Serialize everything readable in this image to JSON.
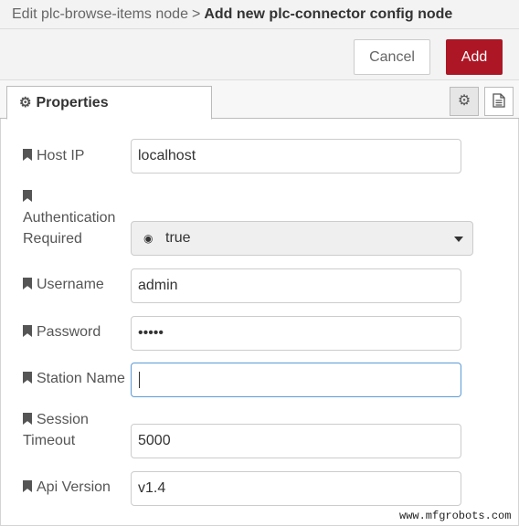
{
  "header": {
    "breadcrumb_parent": "Edit plc-browse-items node",
    "separator": ">",
    "breadcrumb_current": "Add new plc-connector config node"
  },
  "toolbar": {
    "cancel_label": "Cancel",
    "add_label": "Add",
    "accent_color": "#ad1625"
  },
  "tabs": {
    "properties_label": "Properties",
    "settings_icon": "gear-icon",
    "description_icon": "document-icon"
  },
  "form": {
    "host_ip": {
      "label": "Host IP",
      "value": "localhost"
    },
    "auth_required": {
      "label_line1": "Authentication",
      "label_line2": "Required",
      "value": "true",
      "icon": "boolean-icon"
    },
    "username": {
      "label": "Username",
      "value": "admin"
    },
    "password": {
      "label": "Password",
      "value": "•••••"
    },
    "station_name": {
      "label": "Station Name",
      "value": ""
    },
    "session_timeout": {
      "label_line1": "Session",
      "label_line2": "Timeout",
      "value": "5000"
    },
    "api_version": {
      "label": "Api Version",
      "value": "v1.4"
    }
  },
  "watermark": "www.mfgrobots.com"
}
